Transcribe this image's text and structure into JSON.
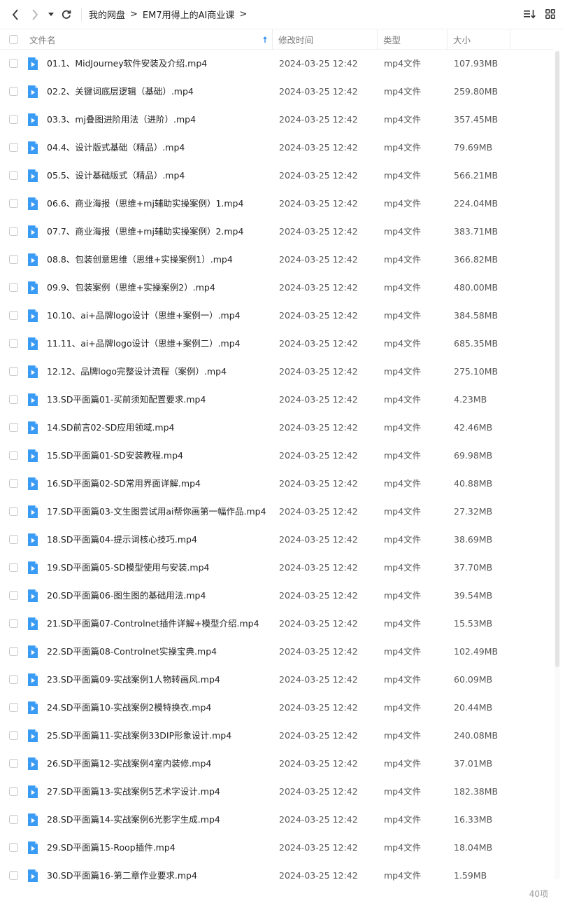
{
  "breadcrumb": {
    "items": [
      "我的网盘",
      "EM7用得上的AI商业课"
    ],
    "separator": ">"
  },
  "columns": {
    "name": "文件名",
    "modified": "修改时间",
    "type": "类型",
    "size": "大小"
  },
  "files": [
    {
      "name": "01.1、MidJourney软件安装及介绍.mp4",
      "modified": "2024-03-25 12:42",
      "type": "mp4文件",
      "size": "107.93MB"
    },
    {
      "name": "02.2、关键词底层逻辑（基础）.mp4",
      "modified": "2024-03-25 12:42",
      "type": "mp4文件",
      "size": "259.80MB"
    },
    {
      "name": "03.3、mj叠图进阶用法（进阶）.mp4",
      "modified": "2024-03-25 12:42",
      "type": "mp4文件",
      "size": "357.45MB"
    },
    {
      "name": "04.4、设计版式基础（精品）.mp4",
      "modified": "2024-03-25 12:42",
      "type": "mp4文件",
      "size": "79.69MB"
    },
    {
      "name": "05.5、设计基础版式（精品）.mp4",
      "modified": "2024-03-25 12:42",
      "type": "mp4文件",
      "size": "566.21MB"
    },
    {
      "name": "06.6、商业海报（思维+mj辅助实操案例）1.mp4",
      "modified": "2024-03-25 12:42",
      "type": "mp4文件",
      "size": "224.04MB"
    },
    {
      "name": "07.7、商业海报（思维+mj辅助实操案例）2.mp4",
      "modified": "2024-03-25 12:42",
      "type": "mp4文件",
      "size": "383.71MB"
    },
    {
      "name": "08.8、包装创意思维（思维+实操案例1）.mp4",
      "modified": "2024-03-25 12:42",
      "type": "mp4文件",
      "size": "366.82MB"
    },
    {
      "name": "09.9、包装案例（思维+实操案例2）.mp4",
      "modified": "2024-03-25 12:42",
      "type": "mp4文件",
      "size": "480.00MB"
    },
    {
      "name": "10.10、ai+品牌logo设计（思维+案例一）.mp4",
      "modified": "2024-03-25 12:42",
      "type": "mp4文件",
      "size": "384.58MB"
    },
    {
      "name": "11.11、ai+品牌logo设计（思维+案例二）.mp4",
      "modified": "2024-03-25 12:42",
      "type": "mp4文件",
      "size": "685.35MB"
    },
    {
      "name": "12.12、品牌logo完整设计流程（案例）.mp4",
      "modified": "2024-03-25 12:42",
      "type": "mp4文件",
      "size": "275.10MB"
    },
    {
      "name": "13.SD平面篇01-买前须知配置要求.mp4",
      "modified": "2024-03-25 12:42",
      "type": "mp4文件",
      "size": "4.23MB"
    },
    {
      "name": "14.SD前言02-SD应用领域.mp4",
      "modified": "2024-03-25 12:42",
      "type": "mp4文件",
      "size": "42.46MB"
    },
    {
      "name": "15.SD平面篇01-SD安装教程.mp4",
      "modified": "2024-03-25 12:42",
      "type": "mp4文件",
      "size": "69.98MB"
    },
    {
      "name": "16.SD平面篇02-SD常用界面详解.mp4",
      "modified": "2024-03-25 12:42",
      "type": "mp4文件",
      "size": "40.88MB"
    },
    {
      "name": "17.SD平面篇03-文生图尝试用ai帮你画第一幅作品.mp4",
      "modified": "2024-03-25 12:42",
      "type": "mp4文件",
      "size": "27.32MB"
    },
    {
      "name": "18.SD平面篇04-提示词核心技巧.mp4",
      "modified": "2024-03-25 12:42",
      "type": "mp4文件",
      "size": "38.69MB"
    },
    {
      "name": "19.SD平面篇05-SD模型使用与安装.mp4",
      "modified": "2024-03-25 12:42",
      "type": "mp4文件",
      "size": "37.70MB"
    },
    {
      "name": "20.SD平面篇06-图生图的基础用法.mp4",
      "modified": "2024-03-25 12:42",
      "type": "mp4文件",
      "size": "39.54MB"
    },
    {
      "name": "21.SD平面篇07-Controlnet插件详解+模型介绍.mp4",
      "modified": "2024-03-25 12:42",
      "type": "mp4文件",
      "size": "15.53MB"
    },
    {
      "name": "22.SD平面篇08-Controlnet实操宝典.mp4",
      "modified": "2024-03-25 12:42",
      "type": "mp4文件",
      "size": "102.49MB"
    },
    {
      "name": "23.SD平面篇09-实战案例1人物转画风.mp4",
      "modified": "2024-03-25 12:42",
      "type": "mp4文件",
      "size": "60.09MB"
    },
    {
      "name": "24.SD平面篇10-实战案例2模特换衣.mp4",
      "modified": "2024-03-25 12:42",
      "type": "mp4文件",
      "size": "20.44MB"
    },
    {
      "name": "25.SD平面篇11-实战案例33DIP形象设计.mp4",
      "modified": "2024-03-25 12:42",
      "type": "mp4文件",
      "size": "240.08MB"
    },
    {
      "name": "26.SD平面篇12-实战案例4室内装修.mp4",
      "modified": "2024-03-25 12:42",
      "type": "mp4文件",
      "size": "37.01MB"
    },
    {
      "name": "27.SD平面篇13-实战案例5艺术字设计.mp4",
      "modified": "2024-03-25 12:42",
      "type": "mp4文件",
      "size": "182.38MB"
    },
    {
      "name": "28.SD平面篇14-实战案例6光影字生成.mp4",
      "modified": "2024-03-25 12:42",
      "type": "mp4文件",
      "size": "16.33MB"
    },
    {
      "name": "29.SD平面篇15-Roop插件.mp4",
      "modified": "2024-03-25 12:42",
      "type": "mp4文件",
      "size": "18.04MB"
    },
    {
      "name": "30.SD平面篇16-第二章作业要求.mp4",
      "modified": "2024-03-25 12:42",
      "type": "mp4文件",
      "size": "1.59MB"
    }
  ],
  "footer": {
    "count": "40项"
  },
  "colors": {
    "accent": "#2f8ff0",
    "file_icon": "#3a9bf4"
  },
  "icons": {
    "back": "back-arrow-icon",
    "forward": "forward-arrow-icon",
    "dropdown": "dropdown-caret-icon",
    "refresh": "refresh-icon",
    "sort": "sort-icon",
    "grid": "grid-view-icon",
    "video_file": "video-file-icon"
  }
}
